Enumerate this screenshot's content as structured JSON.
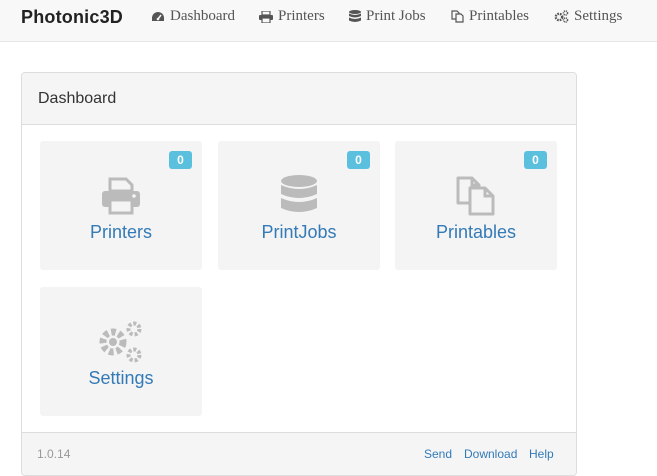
{
  "navbar": {
    "brand": "Photonic3D",
    "items": [
      {
        "label": "Dashboard",
        "icon": "dashboard-icon"
      },
      {
        "label": "Printers",
        "icon": "printer-icon"
      },
      {
        "label": "Print Jobs",
        "icon": "database-icon"
      },
      {
        "label": "Printables",
        "icon": "files-icon"
      },
      {
        "label": "Settings",
        "icon": "gears-icon"
      }
    ]
  },
  "panel": {
    "title": "Dashboard",
    "tiles": [
      {
        "label": "Printers",
        "count": "0",
        "icon": "printer-icon"
      },
      {
        "label": "PrintJobs",
        "count": "0",
        "icon": "database-icon"
      },
      {
        "label": "Printables",
        "count": "0",
        "icon": "files-icon"
      },
      {
        "label": "Settings",
        "icon": "gears-icon"
      }
    ],
    "footer": {
      "version": "1.0.14",
      "links": [
        "Send",
        "Download",
        "Help"
      ]
    }
  },
  "colors": {
    "link": "#337ab7",
    "badge": "#5bc0de",
    "icon": "#bbbbbb",
    "nav_text": "#555555"
  }
}
